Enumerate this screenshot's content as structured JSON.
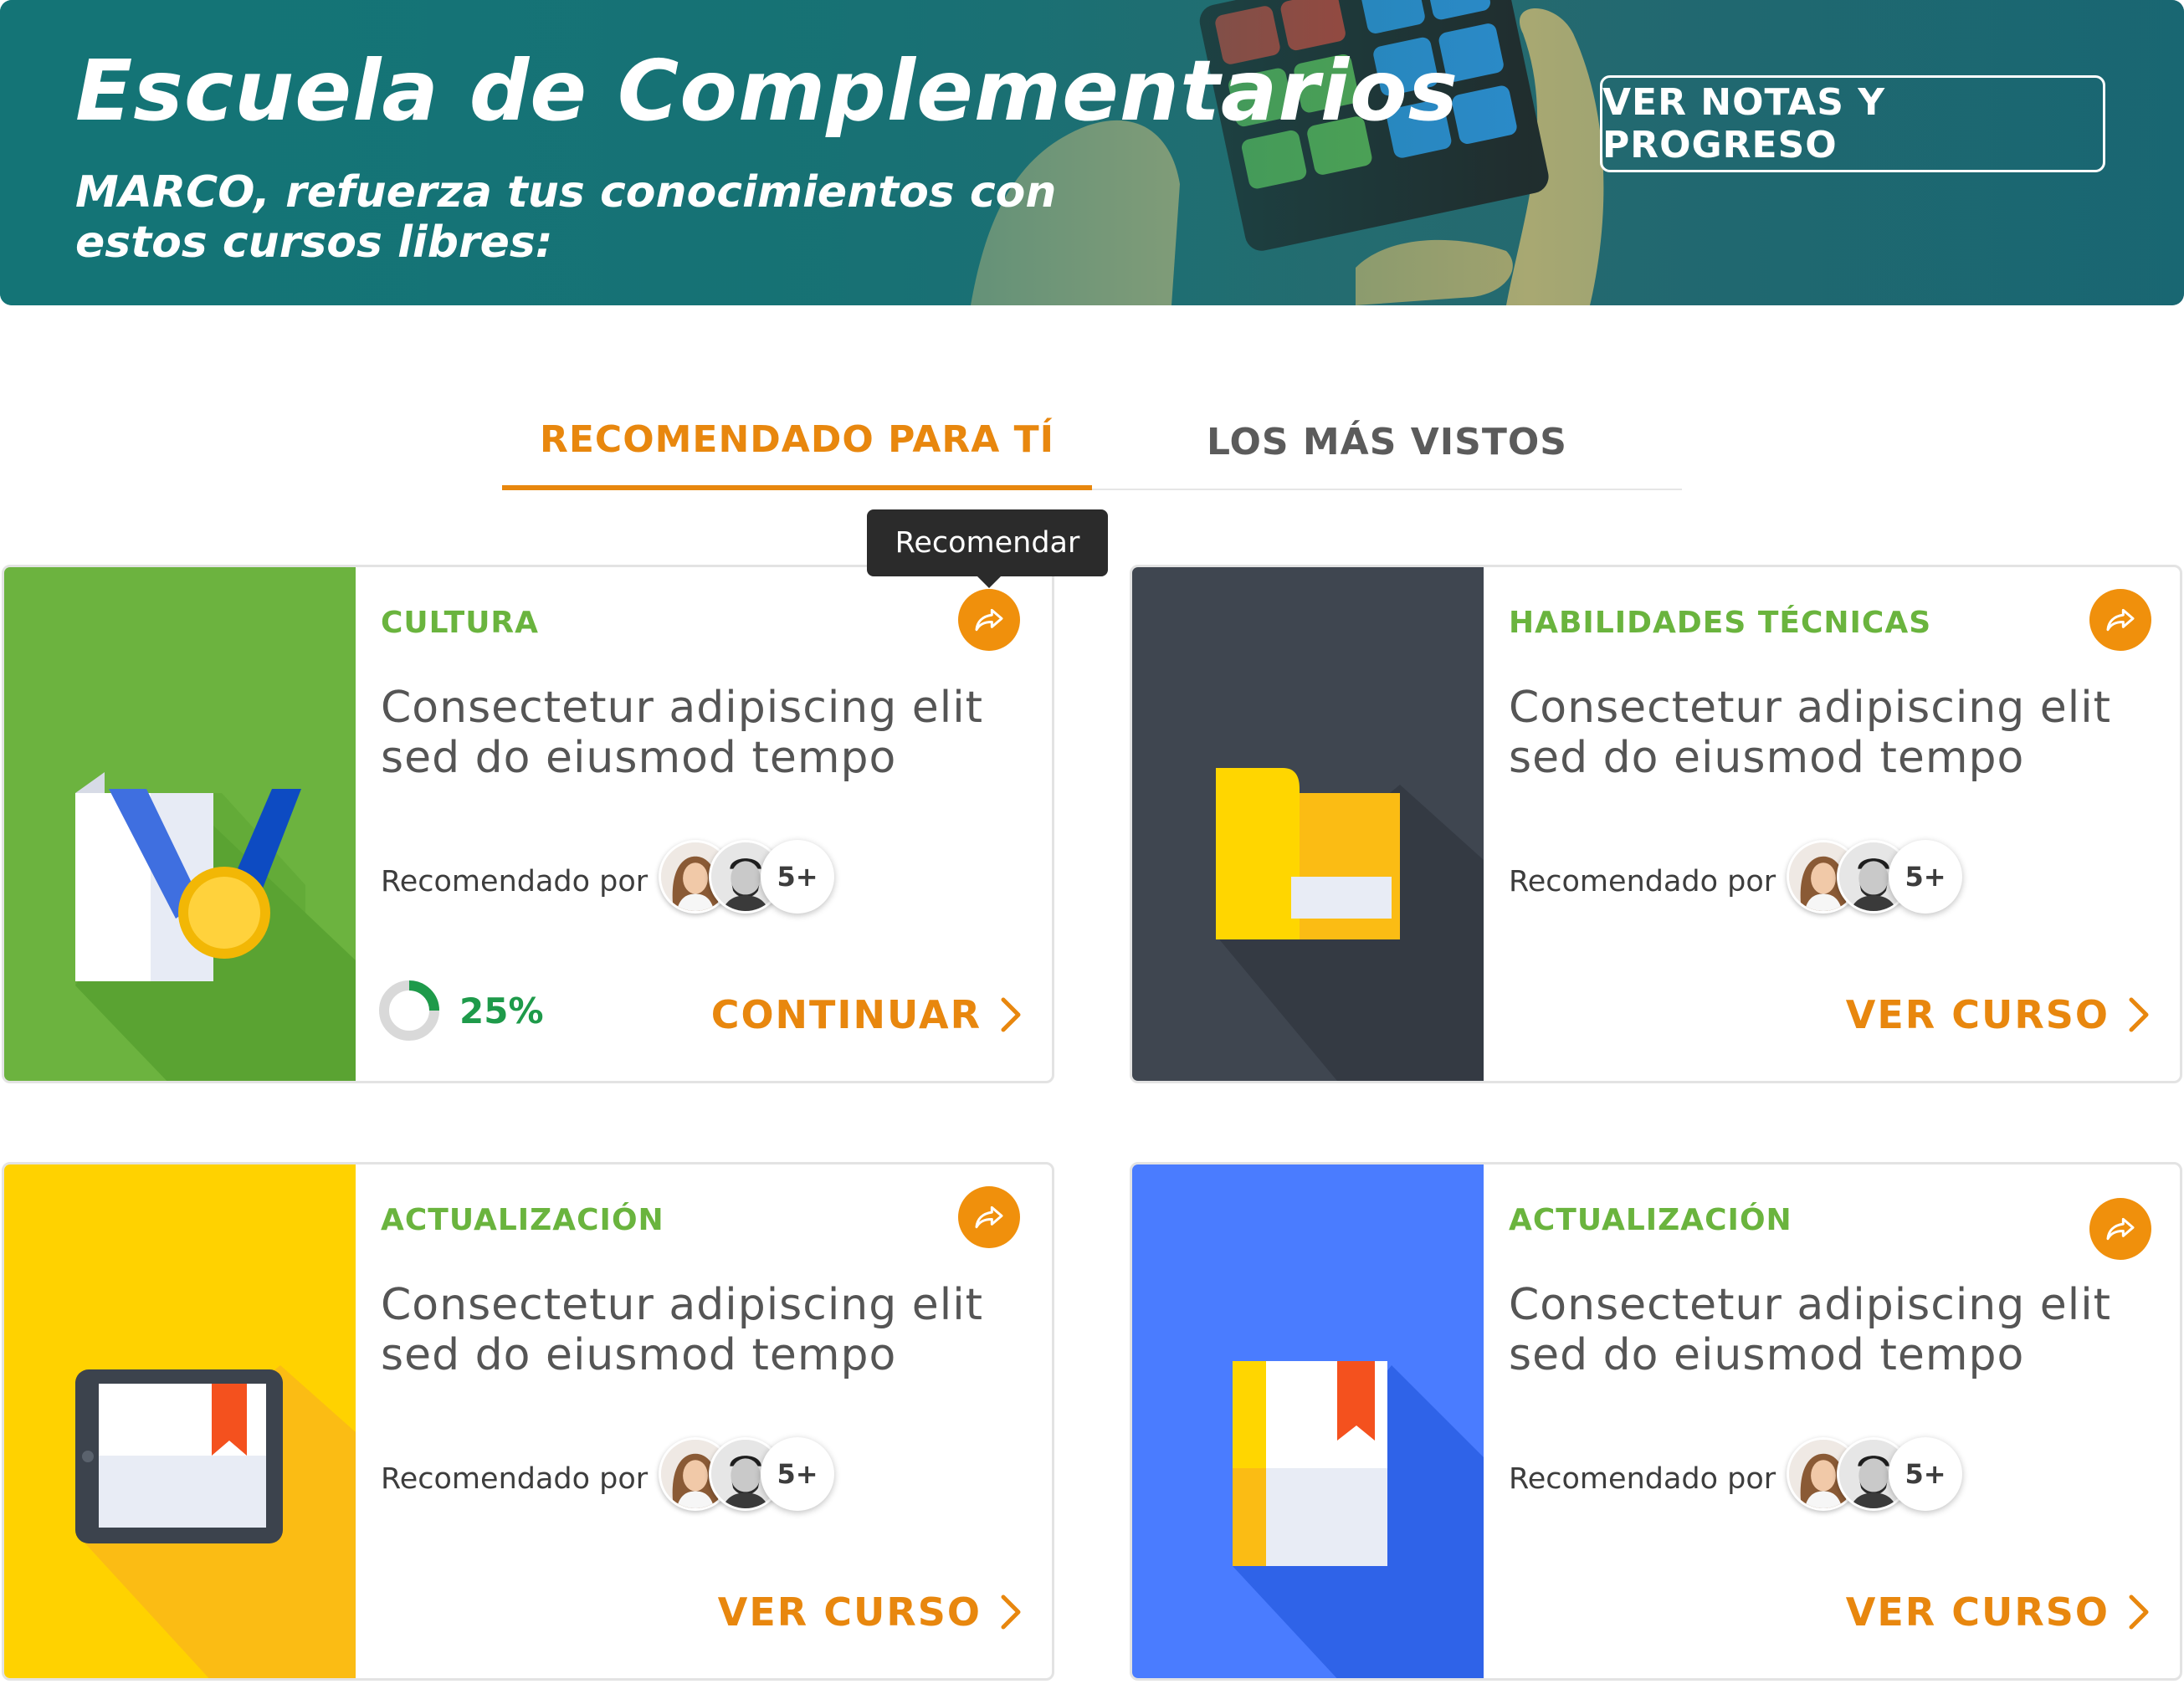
{
  "hero": {
    "title": "Escuela de Complementarios",
    "subtitle": "MARCO, refuerza tus conocimientos con estos cursos libres:",
    "button_label": "VER NOTAS Y PROGRESO"
  },
  "tabs": [
    {
      "label": "RECOMENDADO PARA TÍ",
      "active": true
    },
    {
      "label": "LOS MÁS VISTOS",
      "active": false
    }
  ],
  "tooltip": "Recomendar",
  "cards": [
    {
      "category": "CULTURA",
      "title": "Consectetur adipiscing elit sed do eiusmod tempo",
      "recommended_by": "Recomendado por",
      "more_count": "5+",
      "progress": "25%",
      "progress_value": 0.25,
      "cta": "CONTINUAR",
      "image_icon": "medal-document-icon",
      "image_color": "#6cb33f"
    },
    {
      "category": "HABILIDADES TÉCNICAS",
      "title": "Consectetur adipiscing elit sed do eiusmod tempo",
      "recommended_by": "Recomendado por",
      "more_count": "5+",
      "cta": "VER CURSO",
      "image_icon": "folder-icon",
      "image_color": "#3f4650"
    },
    {
      "category": "ACTUALIZACIÓN",
      "title": "Consectetur adipiscing elit sed do eiusmod tempo",
      "recommended_by": "Recomendado por",
      "more_count": "5+",
      "cta": "VER CURSO",
      "image_icon": "tablet-ebook-icon",
      "image_color": "#ffd200"
    },
    {
      "category": "ACTUALIZACIÓN",
      "title": "Consectetur adipiscing elit sed do eiusmod tempo",
      "recommended_by": "Recomendado por",
      "more_count": "5+",
      "cta": "VER CURSO",
      "image_icon": "book-icon",
      "image_color": "#4a7cff"
    }
  ],
  "colors": {
    "accent": "#e8870e",
    "category_green": "#6ab43e",
    "progress_green": "#1e9a4a",
    "hero_teal": "#157b7a"
  }
}
